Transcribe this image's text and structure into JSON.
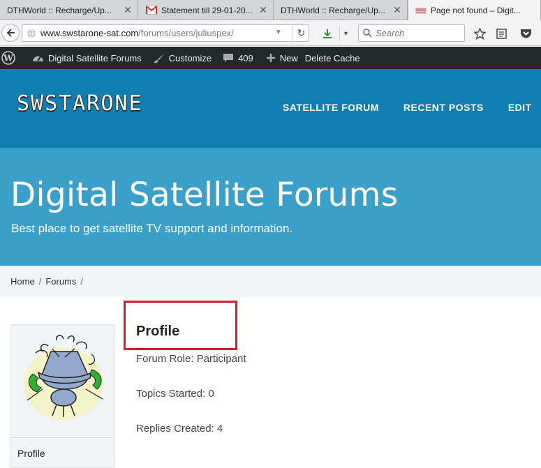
{
  "browser": {
    "tabs": [
      {
        "label": "DTHWorld :: Recharge/Up...",
        "icon": "blank-page-icon",
        "active": false
      },
      {
        "label": "Statement till 29-01-20...",
        "icon": "gmail-icon",
        "active": false
      },
      {
        "label": "DTHWorld :: Recharge/Up...",
        "icon": "blank-page-icon",
        "active": false
      },
      {
        "label": "Page not found – Digit...",
        "icon": "site-favicon-icon",
        "active": true
      }
    ],
    "url_domain": "www.swstarone-sat.com",
    "url_path": "/forums/users/juliuspex/",
    "search_placeholder": "Search"
  },
  "adminbar": {
    "site_name": "Digital Satellite Forums",
    "customize": "Customize",
    "comments_count": "409",
    "new_label": "New",
    "delete_cache": "Delete Cache"
  },
  "site": {
    "logo_text": "SWSTARONE",
    "nav": [
      "SATELLITE FORUM",
      "RECENT POSTS",
      "EDIT"
    ]
  },
  "hero": {
    "title": "Digital Satellite Forums",
    "tagline": "Best place to get satellite TV support and information."
  },
  "breadcrumb": [
    "Home",
    "Forums"
  ],
  "sidebar": {
    "profile_link": "Profile"
  },
  "profile": {
    "heading": "Profile",
    "forum_role": "Forum Role: Participant",
    "topics_started": "Topics Started: 0",
    "replies_created": "Replies Created: 4"
  },
  "colors": {
    "header_blue": "#0f7fb1",
    "hero_blue": "#3aa0c9",
    "admin_bar": "#23282d",
    "highlight_red": "#d32026"
  }
}
